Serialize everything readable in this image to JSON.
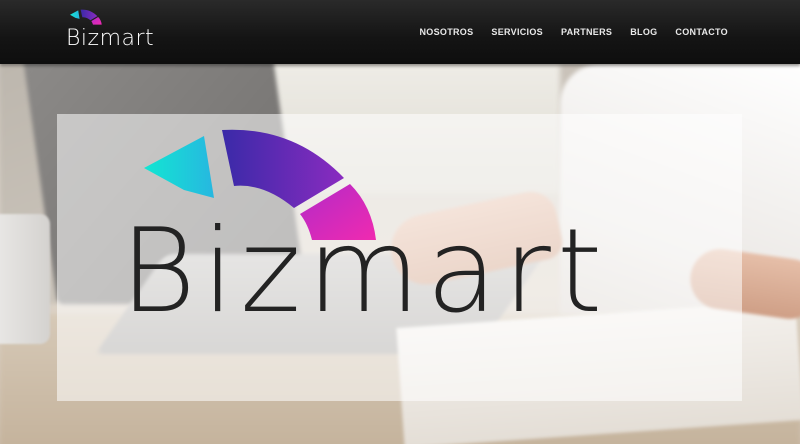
{
  "brand": {
    "name": "Bizmart",
    "colors": {
      "cyan": "#1ee3d6",
      "purple": "#5a2bb0",
      "magenta": "#e02ab8"
    }
  },
  "nav": {
    "items": [
      {
        "label": "NOSOTROS"
      },
      {
        "label": "SERVICIOS"
      },
      {
        "label": "PARTNERS"
      },
      {
        "label": "BLOG"
      },
      {
        "label": "CONTACTO"
      }
    ]
  },
  "hero": {
    "logo_text": "Bizmart"
  }
}
